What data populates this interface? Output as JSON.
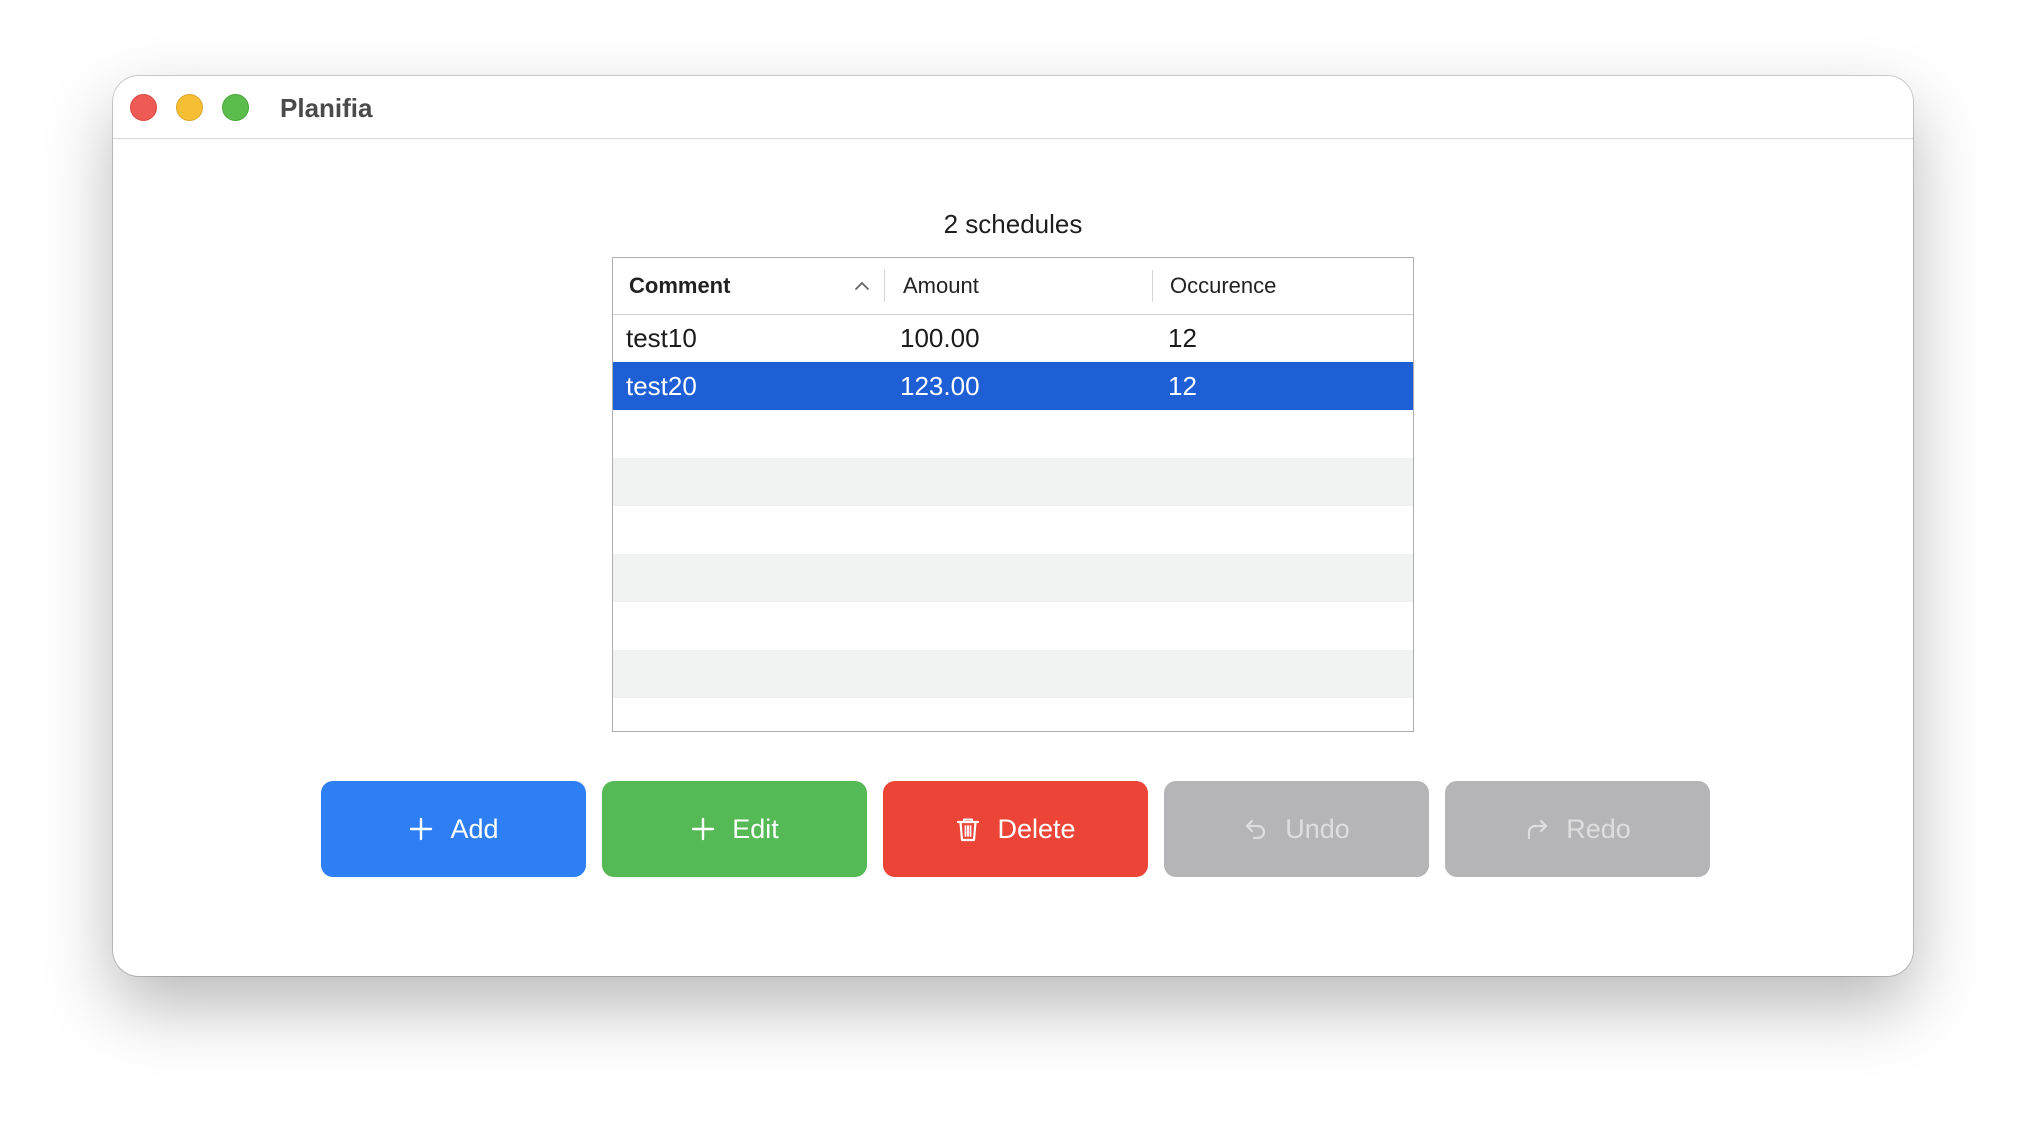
{
  "window": {
    "title": "Planifia"
  },
  "summary": {
    "count_label": "2 schedules"
  },
  "table": {
    "columns": [
      {
        "label": "Comment",
        "sorted": "ascending"
      },
      {
        "label": "Amount"
      },
      {
        "label": "Occurence"
      }
    ],
    "rows": [
      {
        "comment": "test10",
        "amount": "100.00",
        "occurence": "12",
        "selected": false
      },
      {
        "comment": "test20",
        "amount": "123.00",
        "occurence": "12",
        "selected": true
      }
    ],
    "selection_color": "#1f5fd6"
  },
  "actions": {
    "add": {
      "label": "Add",
      "icon": "plus-icon",
      "color": "#2d7ff3"
    },
    "edit": {
      "label": "Edit",
      "icon": "plus-icon",
      "color": "#55b955"
    },
    "delete": {
      "label": "Delete",
      "icon": "trash-icon",
      "color": "#ec4437"
    },
    "undo": {
      "label": "Undo",
      "icon": "undo-arrow-icon",
      "color": "#b5b5b7",
      "enabled": false
    },
    "redo": {
      "label": "Redo",
      "icon": "redo-arrow-icon",
      "color": "#b5b5b7",
      "enabled": false
    }
  }
}
